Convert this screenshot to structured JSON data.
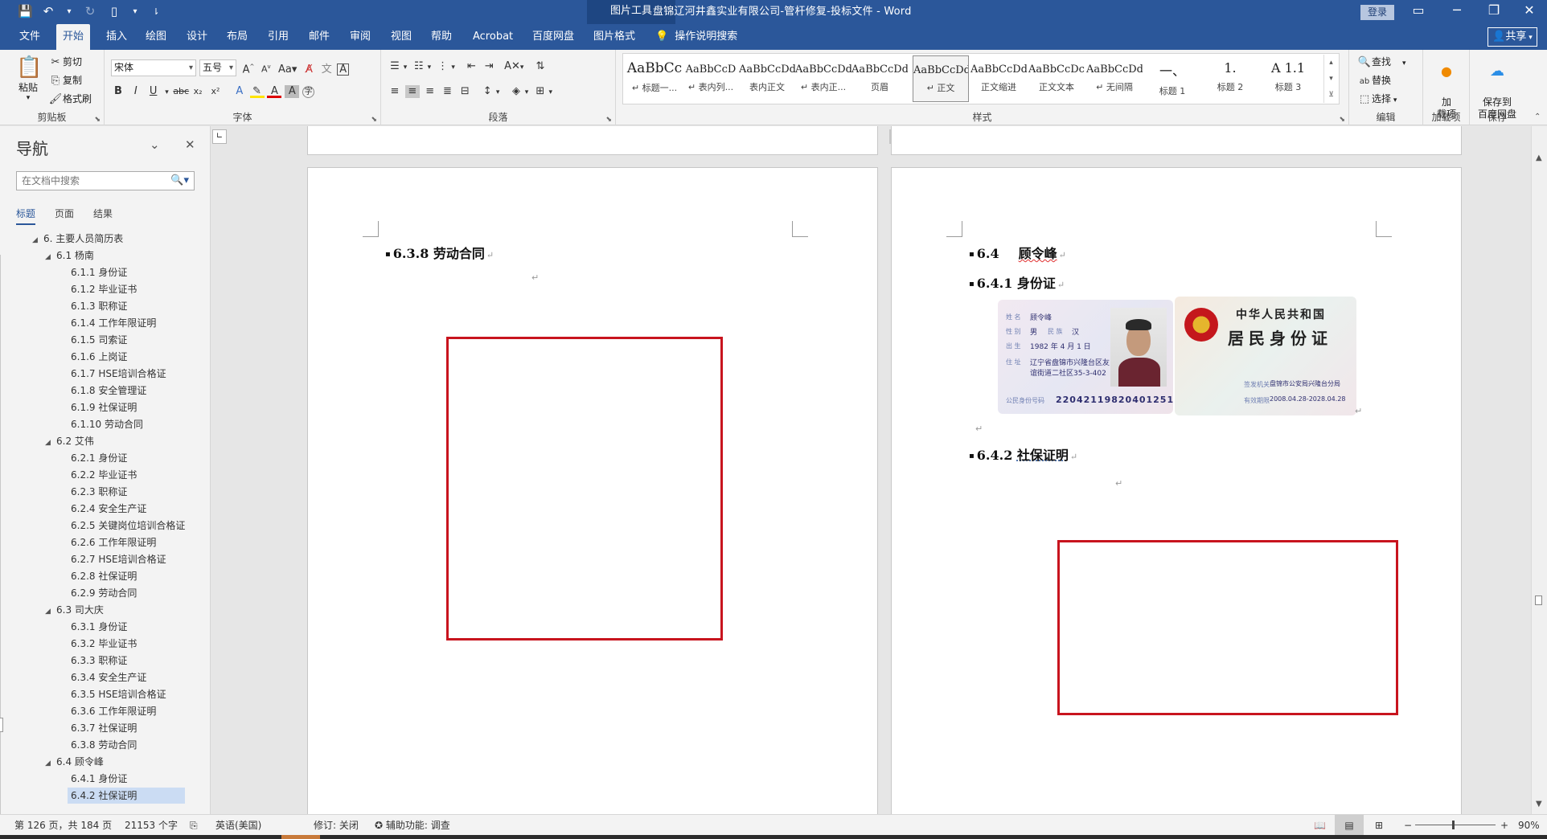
{
  "titlebar": {
    "context_tab": "图片工具",
    "doc_title": "盘锦辽河井鑫实业有限公司-管杆修复-投标文件  -  Word",
    "login": "登录",
    "qat_icons": [
      "save-icon",
      "undo-icon",
      "redo-icon",
      "file-icon",
      "customize-icon"
    ]
  },
  "tabs": {
    "items": [
      "文件",
      "开始",
      "插入",
      "绘图",
      "设计",
      "布局",
      "引用",
      "邮件",
      "审阅",
      "视图",
      "帮助",
      "Acrobat",
      "百度网盘",
      "图片格式"
    ],
    "tell_me": "操作说明搜索",
    "share": "共享"
  },
  "ribbon": {
    "clipboard": {
      "paste": "粘贴",
      "cut": "剪切",
      "copy": "复制",
      "format_painter": "格式刷",
      "label": "剪贴板"
    },
    "font": {
      "name": "宋体",
      "size": "五号",
      "label": "字体"
    },
    "paragraph": {
      "label": "段落"
    },
    "styles": {
      "label": "样式",
      "items": [
        {
          "preview": "AaBbCc",
          "name": "↵ 标题一..."
        },
        {
          "preview": "AaBbCcD",
          "name": "↵ 表内列..."
        },
        {
          "preview": "AaBbCcDd",
          "name": "表内正文"
        },
        {
          "preview": "AaBbCcDd",
          "name": "↵ 表内正..."
        },
        {
          "preview": "AaBbCcDdEe",
          "name": "页眉"
        },
        {
          "preview": "AaBbCcDd",
          "name": "↵ 正文"
        },
        {
          "preview": "AaBbCcDd",
          "name": "正文缩进"
        },
        {
          "preview": "AaBbCcDc",
          "name": "正文文本"
        },
        {
          "preview": "AaBbCcDd",
          "name": "↵ 无间隔"
        },
        {
          "preview": "一、",
          "name": "标题 1"
        },
        {
          "preview": "1.",
          "name": "标题 2"
        },
        {
          "preview": "A 1.1",
          "name": "标题 3"
        }
      ]
    },
    "editing": {
      "find": "查找",
      "replace": "替换",
      "select": "选择",
      "label": "编辑"
    },
    "addins": {
      "button": "加\n载项",
      "label": "加载项"
    },
    "save": {
      "button": "保存到\n百度网盘",
      "label": "保存"
    }
  },
  "nav": {
    "title": "导航",
    "search_placeholder": "在文档中搜索",
    "tabs": [
      "标题",
      "页面",
      "结果"
    ],
    "items": [
      {
        "level": 1,
        "text": "6. 主要人员简历表",
        "caret": "◢"
      },
      {
        "level": 2,
        "text": "6.1 杨南",
        "caret": "◢"
      },
      {
        "level": 3,
        "text": "6.1.1 身份证"
      },
      {
        "level": 3,
        "text": "6.1.2 毕业证书"
      },
      {
        "level": 3,
        "text": "6.1.3 职称证"
      },
      {
        "level": 3,
        "text": "6.1.4 工作年限证明"
      },
      {
        "level": 3,
        "text": "6.1.5 司索证"
      },
      {
        "level": 3,
        "text": "6.1.6 上岗证"
      },
      {
        "level": 3,
        "text": "6.1.7 HSE培训合格证"
      },
      {
        "level": 3,
        "text": "6.1.8 安全管理证"
      },
      {
        "level": 3,
        "text": "6.1.9 社保证明"
      },
      {
        "level": 3,
        "text": "6.1.10 劳动合同"
      },
      {
        "level": 2,
        "text": "6.2 艾伟",
        "caret": "◢"
      },
      {
        "level": 3,
        "text": "6.2.1 身份证"
      },
      {
        "level": 3,
        "text": "6.2.2 毕业证书"
      },
      {
        "level": 3,
        "text": "6.2.3 职称证"
      },
      {
        "level": 3,
        "text": "6.2.4 安全生产证"
      },
      {
        "level": 3,
        "text": "6.2.5 关键岗位培训合格证"
      },
      {
        "level": 3,
        "text": "6.2.6 工作年限证明"
      },
      {
        "level": 3,
        "text": "6.2.7 HSE培训合格证"
      },
      {
        "level": 3,
        "text": "6.2.8 社保证明"
      },
      {
        "level": 3,
        "text": "6.2.9 劳动合同"
      },
      {
        "level": 2,
        "text": "6.3 司大庆",
        "caret": "◢"
      },
      {
        "level": 3,
        "text": "6.3.1 身份证"
      },
      {
        "level": 3,
        "text": "6.3.2 毕业证书"
      },
      {
        "level": 3,
        "text": "6.3.3 职称证"
      },
      {
        "level": 3,
        "text": "6.3.4 安全生产证"
      },
      {
        "level": 3,
        "text": "6.3.5 HSE培训合格证"
      },
      {
        "level": 3,
        "text": "6.3.6 工作年限证明"
      },
      {
        "level": 3,
        "text": "6.3.7 社保证明"
      },
      {
        "level": 3,
        "text": "6.3.8 劳动合同"
      },
      {
        "level": 2,
        "text": "6.4 顾令峰",
        "caret": "◢"
      },
      {
        "level": 3,
        "text": "6.4.1 身份证"
      },
      {
        "level": 3,
        "text": "6.4.2 社保证明",
        "selected": true
      }
    ]
  },
  "ruler": {
    "ticks": [
      "8",
      "6",
      "4",
      "2",
      "",
      "2",
      "4",
      "6",
      "8",
      "10",
      "12",
      "14",
      "16",
      "18",
      "20",
      "22",
      "24",
      "26",
      "28",
      "30",
      "32",
      "34",
      "36",
      "38",
      "40",
      "42",
      "44"
    ]
  },
  "page_left": {
    "heading": "6.3.8 劳动合同",
    "para_mark": "↵"
  },
  "page_right": {
    "heading_64_num": "6.4",
    "heading_64_name": "顾令峰",
    "heading_641": "6.4.1 身份证",
    "heading_642_num": "6.4.2",
    "heading_642_text": "社保证明",
    "para_mark": "↵",
    "id_front": {
      "name_label": "姓  名",
      "name": "顾令峰",
      "sex_label": "性  别",
      "sex": "男",
      "nation_label": "民  族",
      "nation": "汉",
      "birth_label": "出  生",
      "birth": "1982  年  4  月  1  日",
      "addr_label": "住  址",
      "addr1": "辽宁省盘锦市兴隆台区友",
      "addr2": "谊街道二社区35-3-402",
      "idno_label": "公民身份号码",
      "idno": "220421198204012515"
    },
    "id_back": {
      "line1": "中华人民共和国",
      "line2": "居民身份证",
      "issuer_label": "签发机关",
      "issuer": "盘锦市公安局兴隆台分局",
      "valid_label": "有效期限",
      "valid": "2008.04.28-2028.04.28"
    }
  },
  "status": {
    "page": "第 126 页，共 184 页",
    "words": "21153 个字",
    "lang": "英语(美国)",
    "track": "修订: 关闭",
    "access": "辅助功能: 调查",
    "zoom": "90%",
    "zoom_minus": "−",
    "zoom_plus": "+"
  }
}
